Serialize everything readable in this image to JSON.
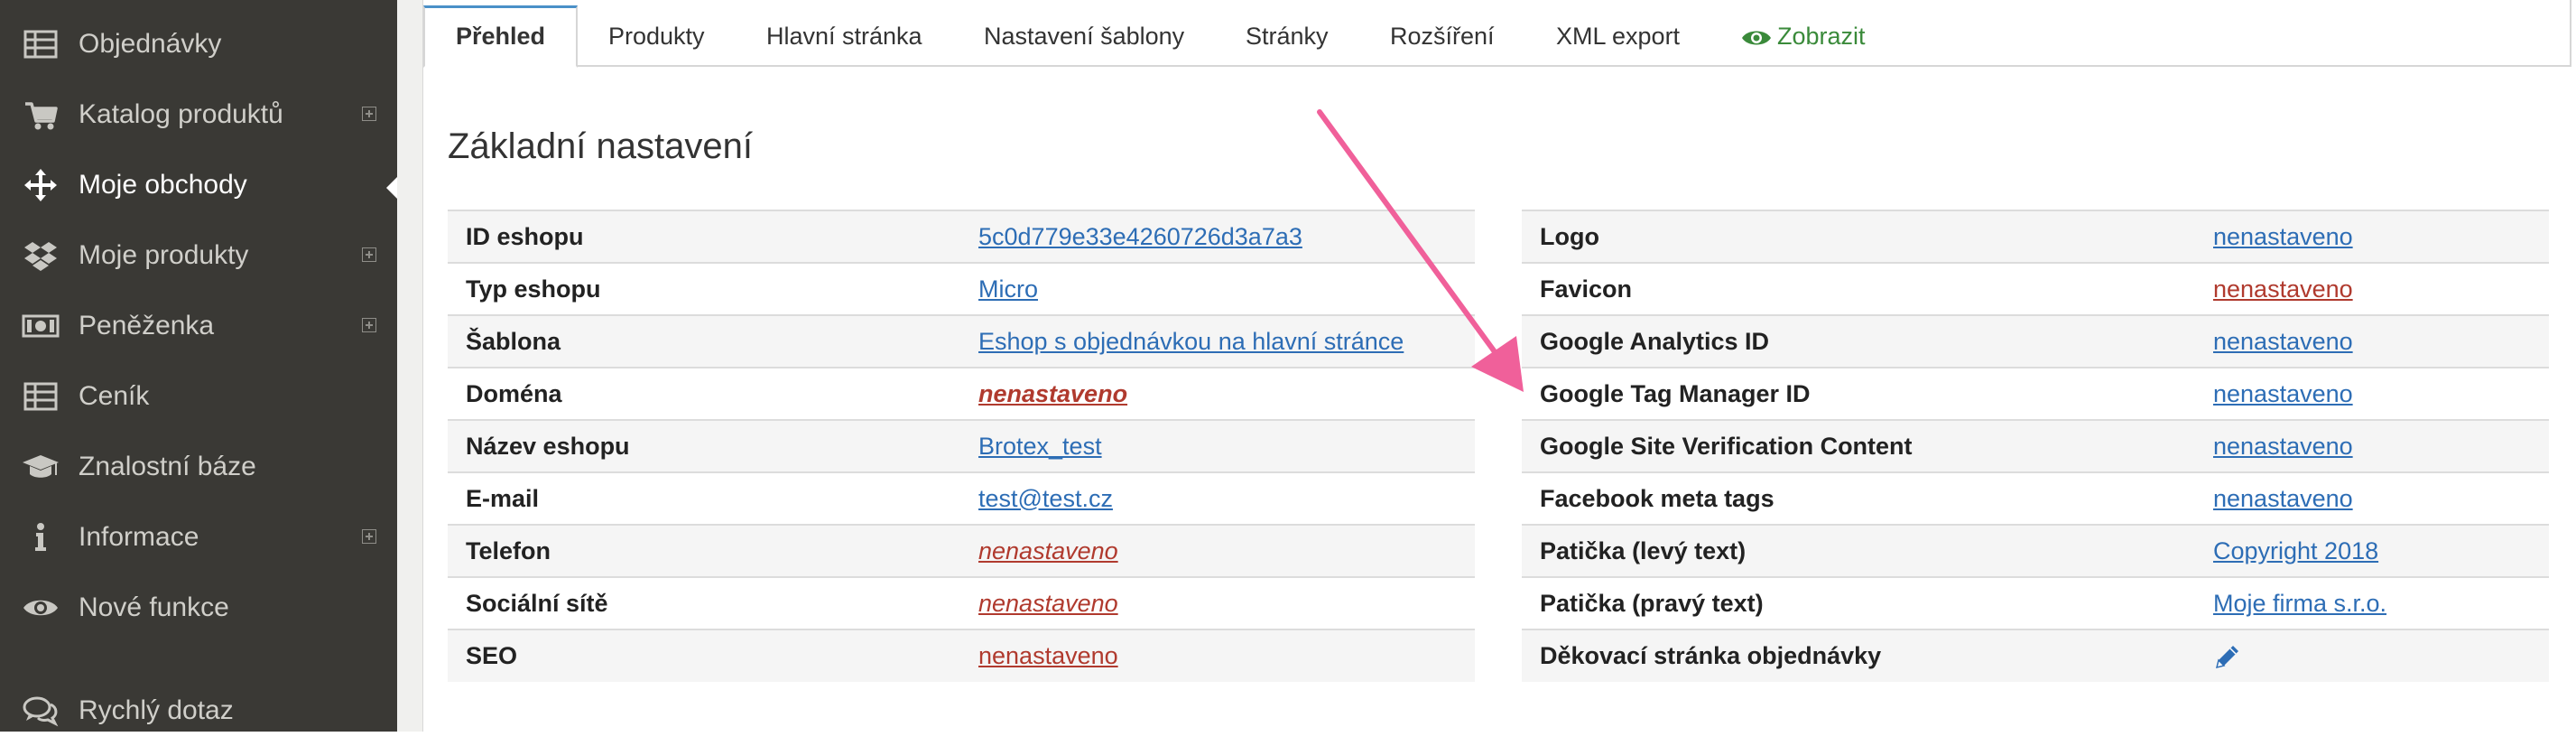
{
  "sidebar": {
    "items": [
      {
        "label": "Objednávky",
        "icon": "table-icon",
        "expandable": false,
        "active": false
      },
      {
        "label": "Katalog produktů",
        "icon": "cart-icon",
        "expandable": true,
        "active": false
      },
      {
        "label": "Moje obchody",
        "icon": "move-icon",
        "expandable": false,
        "active": true
      },
      {
        "label": "Moje produkty",
        "icon": "dropbox-icon",
        "expandable": true,
        "active": false
      },
      {
        "label": "Peněženka",
        "icon": "money-icon",
        "expandable": true,
        "active": false
      },
      {
        "label": "Ceník",
        "icon": "table-icon",
        "expandable": false,
        "active": false
      },
      {
        "label": "Znalostní báze",
        "icon": "graduation-cap-icon",
        "expandable": false,
        "active": false
      },
      {
        "label": "Informace",
        "icon": "info-icon",
        "expandable": true,
        "active": false
      },
      {
        "label": "Nové funkce",
        "icon": "eye-icon",
        "expandable": false,
        "active": false
      },
      {
        "label": "Rychlý dotaz",
        "icon": "comments-icon",
        "expandable": false,
        "active": false
      }
    ]
  },
  "tabs": [
    {
      "label": "Přehled",
      "active": true
    },
    {
      "label": "Produkty",
      "active": false
    },
    {
      "label": "Hlavní stránka",
      "active": false
    },
    {
      "label": "Nastavení šablony",
      "active": false
    },
    {
      "label": "Stránky",
      "active": false
    },
    {
      "label": "Rozšíření",
      "active": false
    },
    {
      "label": "XML export",
      "active": false
    },
    {
      "label": "Zobrazit",
      "active": false,
      "icon": "eye-icon"
    }
  ],
  "main": {
    "title": "Základní nastavení",
    "left_rows": [
      {
        "key": "ID eshopu",
        "value": "5c0d779e33e4260726d3a7a3",
        "style": "link"
      },
      {
        "key": "Typ eshopu",
        "value": "Micro",
        "style": "link"
      },
      {
        "key": "Šablona",
        "value": "Eshop s objednávkou na hlavní stránce",
        "style": "link"
      },
      {
        "key": "Doména",
        "value": "nenastaveno",
        "style": "warn-bold"
      },
      {
        "key": "Název eshopu",
        "value": "Brotex_test",
        "style": "link"
      },
      {
        "key": "E-mail",
        "value": "test@test.cz",
        "style": "link"
      },
      {
        "key": "Telefon",
        "value": "nenastaveno",
        "style": "warn-it"
      },
      {
        "key": "Sociální sítě",
        "value": "nenastaveno",
        "style": "warn-it"
      },
      {
        "key": "SEO",
        "value": "nenastaveno",
        "style": "warn"
      }
    ],
    "right_rows": [
      {
        "key": "Logo",
        "value": "nenastaveno",
        "style": "link"
      },
      {
        "key": "Favicon",
        "value": "nenastaveno",
        "style": "warn"
      },
      {
        "key": "Google Analytics ID",
        "value": "nenastaveno",
        "style": "link"
      },
      {
        "key": "Google Tag Manager ID",
        "value": "nenastaveno",
        "style": "link"
      },
      {
        "key": "Google Site Verification Content",
        "value": "nenastaveno",
        "style": "link"
      },
      {
        "key": "Facebook meta tags",
        "value": "nenastaveno",
        "style": "link"
      },
      {
        "key": "Patička (levý text)",
        "value": "Copyright 2018",
        "style": "link"
      },
      {
        "key": "Patička (pravý text)",
        "value": "Moje firma s.r.o.",
        "style": "link"
      },
      {
        "key": "Děkovací stránka objednávky",
        "value": "",
        "style": "pencil",
        "icon": "pencil-icon"
      }
    ]
  },
  "colors": {
    "sidebar_bg": "#3a3935",
    "link": "#2d6db5",
    "warning": "#b03a2e",
    "view_tab": "#3a8a3a",
    "active_tab_accent": "#4a90c8",
    "annotation_arrow": "#f0609a"
  }
}
